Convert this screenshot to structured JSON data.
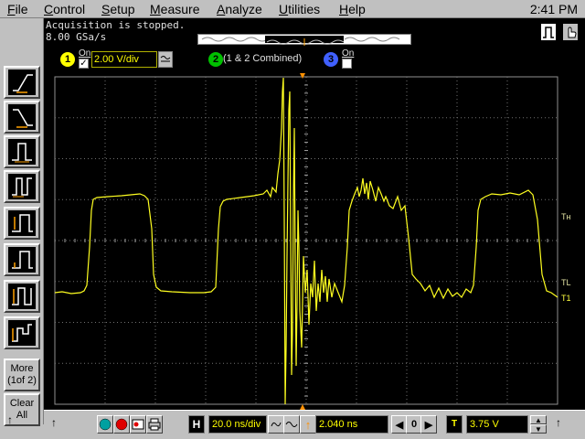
{
  "menu": {
    "items": [
      "File",
      "Control",
      "Setup",
      "Measure",
      "Analyze",
      "Utilities",
      "Help"
    ],
    "clock": "2:41 PM"
  },
  "status": {
    "acquisition": "Acquisition is stopped.",
    "sample_rate": "8.00 GSa/s"
  },
  "channels": {
    "ch1": {
      "number": "1",
      "on_label": "On",
      "checked": true,
      "scale": "2.00 V/div",
      "color": "#ffff00"
    },
    "ch2": {
      "number": "2",
      "label": "(1 & 2 Combined)",
      "color": "#00c000"
    },
    "ch3": {
      "number": "3",
      "on_label": "On",
      "checked": false,
      "color": "#4060ff"
    }
  },
  "toolbar": {
    "more_label_1": "More",
    "more_label_2": "(1of 2)",
    "clear_label_1": "Clear",
    "clear_label_2": "All"
  },
  "markers": {
    "th": "Tн",
    "tl": "TL",
    "t1": "T1"
  },
  "bottom": {
    "horizontal_label": "H",
    "timebase": "20.0 ns/div",
    "delay": "2.040 ns",
    "delay_step": "0",
    "trigger_label": "T",
    "trigger_level": "3.75 V"
  }
}
